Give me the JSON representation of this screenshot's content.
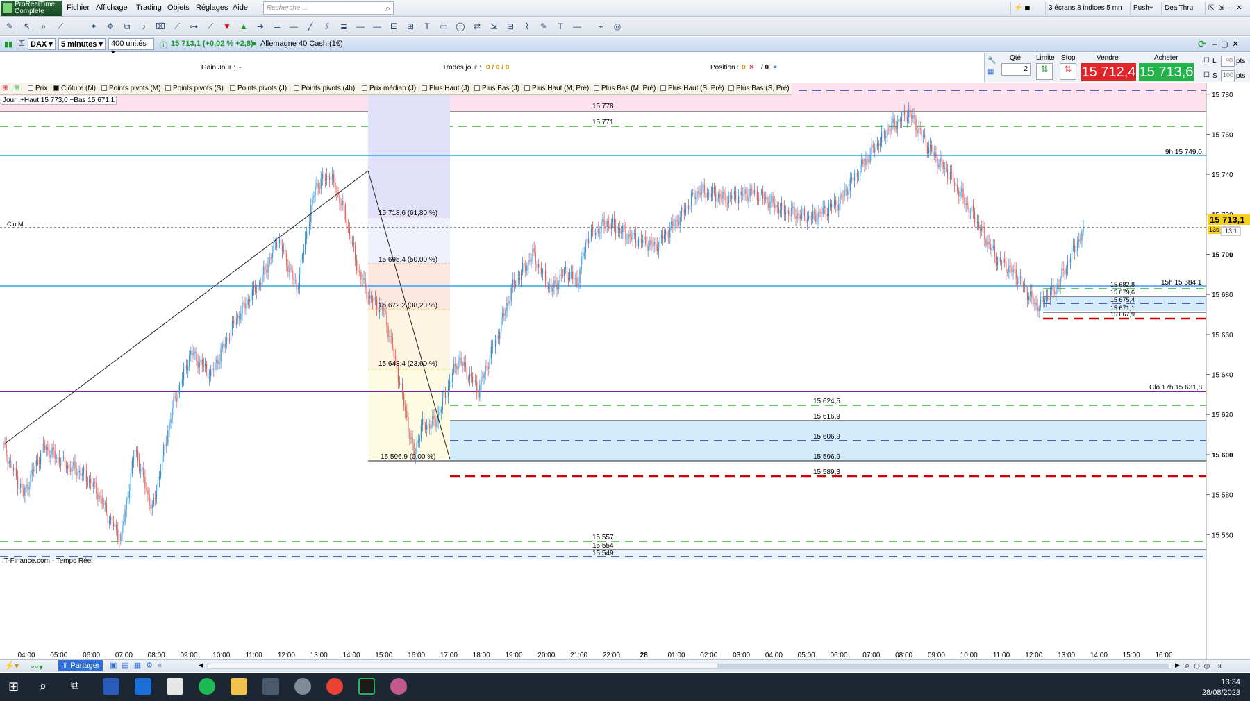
{
  "app": {
    "logo_line1": "ProRealTime",
    "logo_line2": "Complete"
  },
  "menu": [
    "Fichier",
    "Affichage",
    "Trading",
    "Objets",
    "Réglages",
    "Aide"
  ],
  "search": {
    "placeholder": "Recherche ..."
  },
  "top_right": {
    "screens": "3 écrans 8 indices 5 mn",
    "push": "Push+",
    "dealthru": "DealThru"
  },
  "instrument": {
    "ticker": "DAX",
    "timeframe": "5 minutes",
    "units": "400 unités",
    "price_line": "15 713,1 (+0,02 % +2,8)",
    "name": "Allemagne 40 Cash (1€)"
  },
  "info": {
    "gain_label": "Gain Jour :",
    "gain_value": "-",
    "trades_label": "Trades jour :",
    "trades_value": "0 / 0 / 0",
    "position_label": "Position :",
    "position_value": "0",
    "position_sep": "/ 0"
  },
  "order_panel": {
    "qty_label": "Qté",
    "qty_value": "2",
    "limit_label": "Limite",
    "stop_label": "Stop",
    "sell_label": "Vendre",
    "buy_label": "Acheter",
    "sell_price": "15 712,4",
    "buy_price": "15 713,6",
    "l_label": "L",
    "l_value": "90",
    "s_label": "S",
    "s_value": "100",
    "unit": "pts"
  },
  "indicators": [
    "Prix",
    "Clôture (M)",
    "Points pivots (M)",
    "Points pivots (S)",
    "Points pivots (J)",
    "Points pivots (4h)",
    "Prix médian (J)",
    "Plus Haut (J)",
    "Plus Bas (J)",
    "Plus Haut (M, Pré)",
    "Plus Bas (M, Pré)",
    "Plus Haut (S, Pré)",
    "Plus Bas (S, Pré)"
  ],
  "jour_label": "Jour :+Haut 15 773,0 +Bas 15 671,1",
  "chart_labels": {
    "clo_m": "Clo M",
    "l15778": "15 778",
    "l15771": "15 771",
    "l15557": "15 557",
    "l15554": "15 554",
    "l15549": "15 549",
    "h9": "9h 15 749,0",
    "h15": "15h 15 684,1",
    "clo17": "Clo 17h 15 631,8",
    "z15624": "15 624,5",
    "z15616": "15 616,9",
    "z15606": "15 606,9",
    "z15596": "15 596,9",
    "z15589": "15 589,3",
    "r15682": "15 682,8",
    "r15679": "15 679,6",
    "r15675": "15 675,4",
    "r15671": "15 671,1",
    "r15667": "15 667,9",
    "fib618": "15 718,6 (61,80 %)",
    "fib50": "15 695,4 (50,00 %)",
    "fib382": "15 672,2 (38,20 %)",
    "fib236": "15 643,4 (23,60 %)",
    "fib0": "15 596,9 (0,00 %)",
    "last_price": "15 713,1",
    "last_tag1": "13s",
    "last_tag2": "13,1",
    "source": "IT-Finance.com - Temps Réel"
  },
  "price_axis": [
    "15 780",
    "15 760",
    "15 740",
    "15 720",
    "15 700",
    "15 680",
    "15 660",
    "15 640",
    "15 620",
    "15 600",
    "15 580",
    "15 560"
  ],
  "time_axis": [
    "04:00",
    "05:00",
    "06:00",
    "07:00",
    "08:00",
    "09:00",
    "10:00",
    "11:00",
    "12:00",
    "13:00",
    "14:00",
    "15:00",
    "16:00",
    "17:00",
    "18:00",
    "19:00",
    "20:00",
    "21:00",
    "22:00",
    "28",
    "01:00",
    "02:00",
    "03:00",
    "04:00",
    "05:00",
    "06:00",
    "07:00",
    "08:00",
    "09:00",
    "10:00",
    "11:00",
    "12:00",
    "13:00",
    "14:00",
    "15:00",
    "16:00"
  ],
  "bottom": {
    "share": "Partager"
  },
  "clock": {
    "time": "13:34",
    "date": "28/08/2023"
  },
  "colors": {
    "up": "#2f8fd6",
    "down": "#e05a5a",
    "blue_line": "#3aa0e6",
    "purple_line": "#7a1fa2",
    "green_dash": "#3caa3c",
    "red_dash": "#cc0000",
    "navy_dash": "#2b3a8c"
  },
  "chart_data": {
    "type": "candlestick",
    "instrument": "DAX",
    "timeframe": "5 minutes",
    "ylim": [
      15549,
      15782
    ],
    "anchors": [
      [
        0,
        15604
      ],
      [
        14,
        15580
      ],
      [
        28,
        15604
      ],
      [
        43,
        15595
      ],
      [
        57,
        15590
      ],
      [
        66,
        15581
      ],
      [
        74,
        15568
      ],
      [
        82,
        15558
      ],
      [
        92,
        15603
      ],
      [
        104,
        15572
      ],
      [
        118,
        15623
      ],
      [
        131,
        15651
      ],
      [
        145,
        15640
      ],
      [
        163,
        15668
      ],
      [
        180,
        15687
      ],
      [
        192,
        15708
      ],
      [
        205,
        15683
      ],
      [
        218,
        15734
      ],
      [
        228,
        15740
      ],
      [
        238,
        15722
      ],
      [
        248,
        15692
      ],
      [
        256,
        15678
      ],
      [
        266,
        15672
      ],
      [
        276,
        15640
      ],
      [
        287,
        15599
      ],
      [
        292,
        15614
      ],
      [
        302,
        15616
      ],
      [
        318,
        15648
      ],
      [
        332,
        15632
      ],
      [
        346,
        15661
      ],
      [
        356,
        15684
      ],
      [
        370,
        15700
      ],
      [
        383,
        15682
      ],
      [
        393,
        15692
      ],
      [
        401,
        15686
      ],
      [
        408,
        15708
      ],
      [
        422,
        15716
      ],
      [
        440,
        15708
      ],
      [
        456,
        15704
      ],
      [
        470,
        15716
      ],
      [
        486,
        15732
      ],
      [
        505,
        15728
      ],
      [
        525,
        15731
      ],
      [
        545,
        15722
      ],
      [
        565,
        15718
      ],
      [
        584,
        15726
      ],
      [
        598,
        15742
      ],
      [
        618,
        15762
      ],
      [
        633,
        15771
      ],
      [
        648,
        15752
      ],
      [
        662,
        15739
      ],
      [
        680,
        15717
      ],
      [
        694,
        15698
      ],
      [
        708,
        15690
      ],
      [
        722,
        15674
      ],
      [
        736,
        15683
      ],
      [
        748,
        15702
      ],
      [
        755,
        15711
      ]
    ]
  }
}
